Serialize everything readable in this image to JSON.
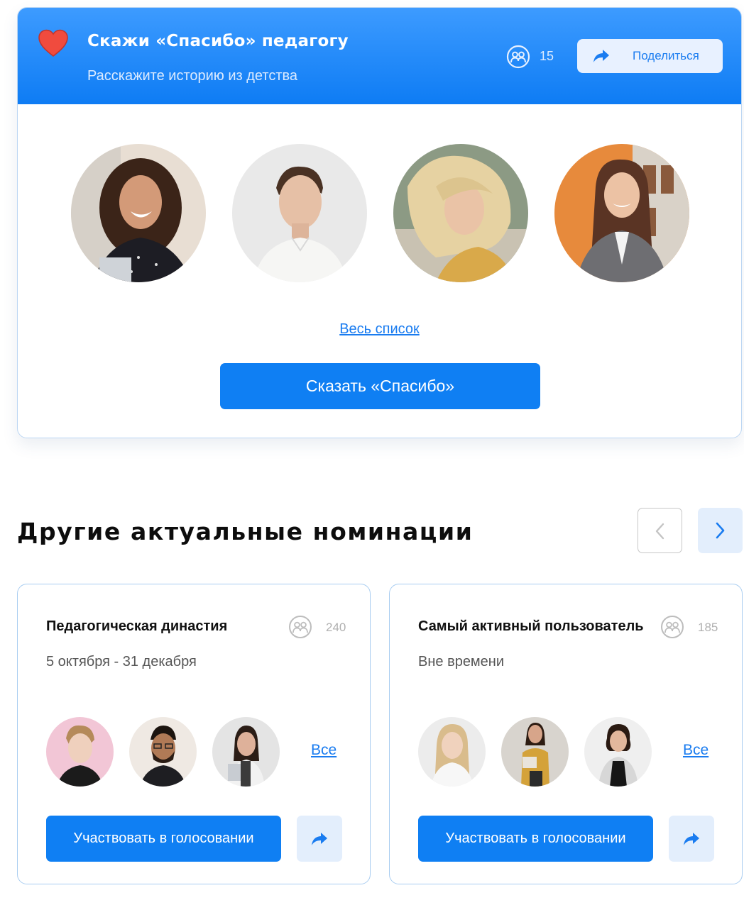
{
  "hero": {
    "title": "Скажи «Спасибо» педагогу",
    "subtitle": "Расскажите историю из детства",
    "participants_count": "15",
    "share_label": "Поделиться",
    "full_list_link": "Весь список",
    "thanks_button": "Сказать «Спасибо»",
    "colors": {
      "header": "#1a87f8",
      "accent": "#0f7ff3",
      "heart": "#f04b3e"
    },
    "icons": [
      "heart-icon",
      "participants-icon",
      "share-arrow-icon"
    ],
    "avatars": [
      {
        "name": "avatar-woman-laughing-curly-hair"
      },
      {
        "name": "avatar-man-white-shirt"
      },
      {
        "name": "avatar-woman-blonde-wind"
      },
      {
        "name": "avatar-woman-long-dark-hair-office"
      }
    ]
  },
  "section": {
    "title": "Другие актуальные номинации",
    "nav": {
      "prev_icon": "chevron-left-icon",
      "next_icon": "chevron-right-icon"
    }
  },
  "nominations": [
    {
      "title": "Педагогическая династия",
      "count": "240",
      "date": "5 октября - 31 декабря",
      "all_link": "Все",
      "vote_button": "Участвовать в голосовании",
      "avatars": [
        {
          "name": "avatar-man-blond-pink-background"
        },
        {
          "name": "avatar-man-beard-glasses"
        },
        {
          "name": "avatar-woman-with-laptop"
        }
      ]
    },
    {
      "title": "Самый активный пользователь",
      "count": "185",
      "date": "Вне времени",
      "all_link": "Все",
      "vote_button": "Участвовать в голосовании",
      "avatars": [
        {
          "name": "avatar-woman-blonde-smiling"
        },
        {
          "name": "avatar-woman-yellow-shirt"
        },
        {
          "name": "avatar-woman-black-top"
        }
      ]
    }
  ]
}
